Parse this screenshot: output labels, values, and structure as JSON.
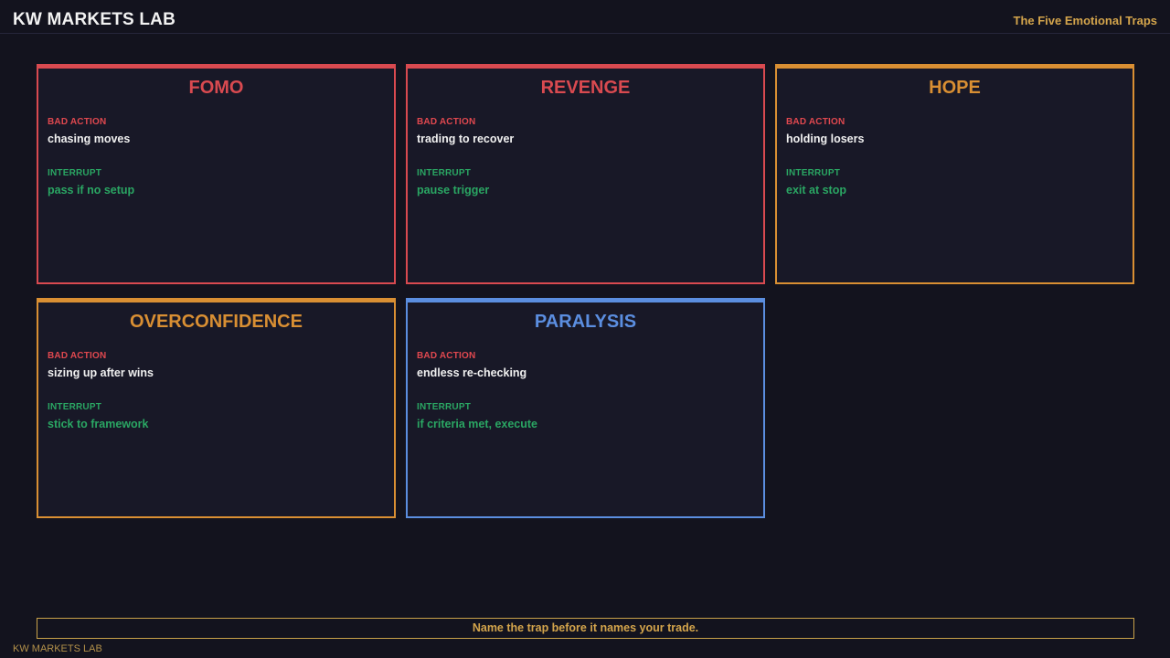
{
  "header": {
    "brand": "KW MARKETS LAB",
    "subtitle": "The Five Emotional Traps"
  },
  "traps": [
    {
      "title": "FOMO",
      "color": "#d94a50",
      "bad_label": "BAD ACTION",
      "bad_action": "chasing moves",
      "interrupt_label": "INTERRUPT",
      "interrupt": "pass if no setup"
    },
    {
      "title": "REVENGE",
      "color": "#d94a50",
      "bad_label": "BAD ACTION",
      "bad_action": "trading to recover",
      "interrupt_label": "INTERRUPT",
      "interrupt": "pause trigger"
    },
    {
      "title": "HOPE",
      "color": "#d98f33",
      "bad_label": "BAD ACTION",
      "bad_action": "holding losers",
      "interrupt_label": "INTERRUPT",
      "interrupt": "exit at stop"
    },
    {
      "title": "OVERCONFIDENCE",
      "color": "#d98f33",
      "bad_label": "BAD ACTION",
      "bad_action": "sizing up after wins",
      "interrupt_label": "INTERRUPT",
      "interrupt": "stick to framework"
    },
    {
      "title": "PARALYSIS",
      "color": "#5b8ee0",
      "bad_label": "BAD ACTION",
      "bad_action": "endless re-checking",
      "interrupt_label": "INTERRUPT",
      "interrupt": "if criteria met, execute"
    }
  ],
  "footer": {
    "tagline": "Name the trap before it names your trade.",
    "brand": "KW MARKETS LAB"
  },
  "colors": {
    "background": "#13131e",
    "card_background": "#181827",
    "bad_label": "#e0484f",
    "interrupt": "#2aa663",
    "accent_gold": "#d4a54c"
  }
}
